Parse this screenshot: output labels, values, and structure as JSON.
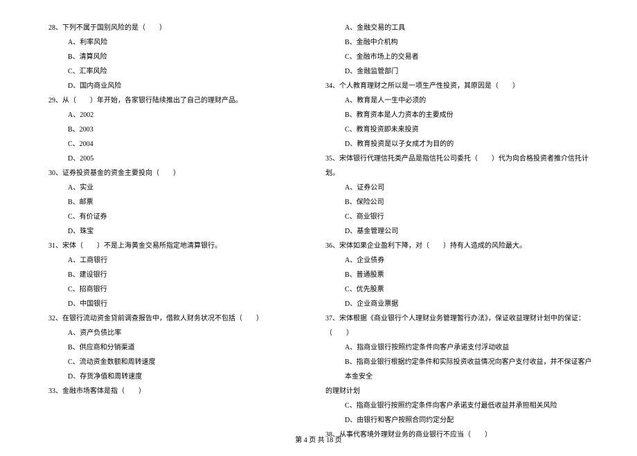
{
  "left_column": {
    "q28": {
      "text": "28、下列不属于国别风险的是（　　）",
      "options": {
        "a": "A、利率风险",
        "b": "B、清算风险",
        "c": "C、汇率风险",
        "d": "D、国内商业风险"
      }
    },
    "q29": {
      "text": "29、从（　　）年开始，各家银行陆续推出了自己的理财产品。",
      "options": {
        "a": "A、2002",
        "b": "B、2003",
        "c": "C、2004",
        "d": "D、2005"
      }
    },
    "q30": {
      "text": "30、证券投资基金的资金主要投向（　　）",
      "options": {
        "a": "A、实业",
        "b": "B、邮票",
        "c": "C、有价证券",
        "d": "D、珠宝"
      }
    },
    "q31": {
      "text": "31、宋体（　　）不是上海黄金交易所指定地清算银行。",
      "options": {
        "a": "A、工商银行",
        "b": "B、建设银行",
        "c": "C、招商银行",
        "d": "D、中国银行"
      }
    },
    "q32": {
      "text": "32、在银行流动资金贷前调查报告中，借款人财务状况不包括（　　）",
      "options": {
        "a": "A、资产负债比率",
        "b": "B、供应商和分销渠道",
        "c": "C、流动资金数额和周转速度",
        "d": "D、存货净值和周转速度"
      }
    },
    "q33": {
      "text": "33、金融市场客体是指（　　）"
    }
  },
  "right_column": {
    "q33_options": {
      "a": "A、金融交易的工具",
      "b": "B、金融中介机构",
      "c": "C、金融市场上的交易者",
      "d": "D、金融监管部门"
    },
    "q34": {
      "text": "34、个人教育理财之所以是一项生产性投资，其原因是（　　）",
      "options": {
        "a": "A、教育是人一生中必须的",
        "b": "B、教育资本是人力资本的主要成份",
        "c": "C、教育投资即未来投资",
        "d": "D、教育投资是以子女成才为目的的"
      }
    },
    "q35": {
      "text": "35、宋体银行代理信托类产品是指信托公司委托（　　）代为向合格投资者推介信托计划。",
      "options": {
        "a": "A、证券公司",
        "b": "B、保险公司",
        "c": "C、商业银行",
        "d": "D、基金管理公司"
      }
    },
    "q36": {
      "text": "36、宋体如果企业盈利下降，对（　　）持有人造成的风险最大。",
      "options": {
        "a": "A、企业债券",
        "b": "B、普通股票",
        "c": "C、优先股票",
        "d": "D、企业商业票据"
      }
    },
    "q37": {
      "text": "37、宋体根据《商业银行个人理财业务管理暂行办法》，保证收益理财计划中的保证：（　　）",
      "options": {
        "a": "A、指商业银行按照约定条件向客户承诺支付浮动收益",
        "b": "B、指商业银行根据约定条件和实际投资收益情况向客户支付收益，并不保证客户本金安全",
        "b_cont": "的理财计划",
        "c": "C、指商业银行按照约定条件向客户承诺支付最低收益并承担相关风险",
        "d": "D、由银行和客户按照合同约定分配"
      }
    },
    "q38": {
      "text": "38、从事代客境外理财业务的商业银行不应当（　　）"
    }
  },
  "footer": "第 4 页 共 18 页"
}
